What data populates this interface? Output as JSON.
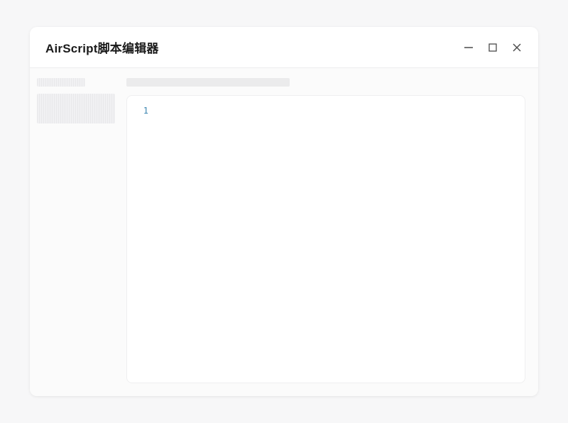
{
  "window": {
    "title": "AirScript脚本编辑器"
  },
  "editor": {
    "line_number": "1",
    "content": ""
  }
}
